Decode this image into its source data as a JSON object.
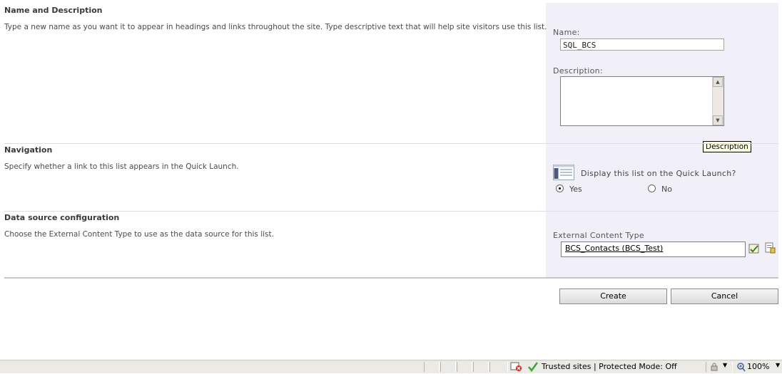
{
  "sections": {
    "name_desc": {
      "title": "Name and Description",
      "text": "Type a new name as you want it to appear in headings and links throughout the site. Type descriptive text that will help site visitors use this list."
    },
    "navigation": {
      "title": "Navigation",
      "text": "Specify whether a link to this list appears in the Quick Launch."
    },
    "datasource": {
      "title": "Data source configuration",
      "text": "Choose the External Content Type to use as the data source for this list."
    }
  },
  "form": {
    "name_label": "Name:",
    "name_value": "SQL_BCS",
    "description_label": "Description:",
    "description_value": "",
    "tooltip": "Description",
    "quicklaunch_label": "Display this list on the Quick Launch?",
    "yes_label": "Yes",
    "no_label": "No",
    "quicklaunch_selected": "Yes",
    "ect_label": "External Content Type",
    "ect_value": "BCS_Contacts (BCS_Test)"
  },
  "buttons": {
    "create": "Create",
    "cancel": "Cancel"
  },
  "statusbar": {
    "zone": "Trusted sites | Protected Mode: Off",
    "zoom": "100%"
  }
}
